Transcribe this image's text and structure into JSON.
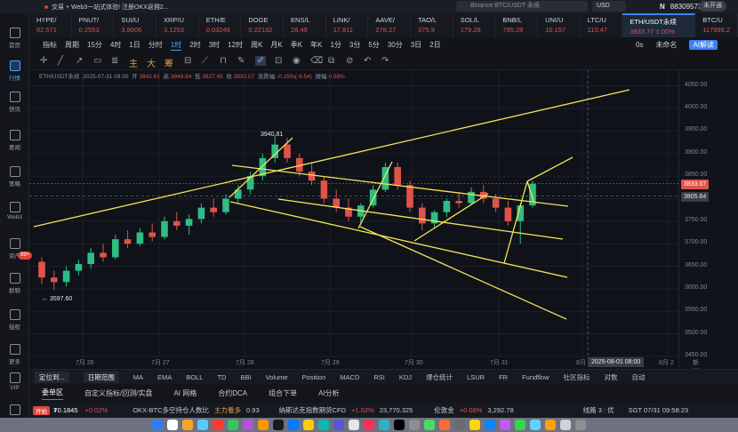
{
  "top_bar": {
    "title": "交易 + Web3一站式体验! 注册OKX返佣2...",
    "search_placeholder": "Binance BTC/USDT 永续",
    "currency": "USD",
    "account_id": "88309573",
    "account_badge": "未开通",
    "n_icon": "N"
  },
  "sidebar": {
    "items": [
      {
        "label": "首页",
        "icon": "home-icon"
      },
      {
        "label": "行情",
        "icon": "chart-icon"
      },
      {
        "label": "快讯",
        "icon": "news-icon"
      },
      {
        "label": "要闻",
        "icon": "article-icon"
      },
      {
        "label": "策略",
        "icon": "strategy-icon"
      },
      {
        "label": "Web3",
        "icon": "web3-icon"
      },
      {
        "label": "资产",
        "icon": "wallet-icon"
      },
      {
        "label": "群聊",
        "icon": "chat-icon"
      },
      {
        "label": "授权",
        "icon": "key-icon"
      },
      {
        "label": "更多",
        "icon": "more-icon"
      },
      {
        "label": "VIP",
        "icon": "vip-icon"
      },
      {
        "label": "",
        "icon": "settings-icon"
      }
    ],
    "badge": "99+"
  },
  "tickers": [
    {
      "name": "HYPE/",
      "price": "62.571",
      "color": "#e0534a"
    },
    {
      "name": "PNUT/",
      "price": "0.2553",
      "color": "#e0534a"
    },
    {
      "name": "SUI/U",
      "price": "3.8006",
      "color": "#e0534a"
    },
    {
      "name": "XRP/U",
      "price": "3.1253",
      "color": "#e0534a"
    },
    {
      "name": "ETH/E",
      "price": "0.03249",
      "color": "#e0534a"
    },
    {
      "name": "DOGE",
      "price": "0.22132",
      "color": "#e0534a"
    },
    {
      "name": "ENS/L",
      "price": "28.49",
      "color": "#e0534a"
    },
    {
      "name": "LINK/",
      "price": "17.811",
      "color": "#e0534a"
    },
    {
      "name": "AAVE/",
      "price": "278.27",
      "color": "#e0534a"
    },
    {
      "name": "TAO/L",
      "price": "375.9",
      "color": "#e0534a"
    },
    {
      "name": "SOL/L",
      "price": "179.29",
      "color": "#e0534a"
    },
    {
      "name": "BNB/L",
      "price": "795.28",
      "color": "#e0534a"
    },
    {
      "name": "UNI/U",
      "price": "10.157",
      "color": "#e0534a"
    },
    {
      "name": "LTC/U",
      "price": "110.47",
      "color": "#e0534a"
    },
    {
      "name": "ETH/USDT永续",
      "price": "3833.77  1.00%",
      "color": "#e0534a",
      "active": true
    },
    {
      "name": "BTC/U",
      "price": "117999.2",
      "color": "#e0534a"
    }
  ],
  "toolbar": {
    "items": [
      "指标",
      "周期",
      "15分",
      "4时",
      "1日",
      "分时",
      "1时",
      "2时",
      "3时",
      "12时",
      "周K",
      "月K",
      "季K",
      "年K",
      "1分",
      "3分",
      "5分",
      "30分",
      "3日",
      "2日"
    ],
    "selected": "1时",
    "right_items": [
      "0s",
      "未命名",
      "AI解读"
    ]
  },
  "legend": {
    "symbol": "ETH/USDT永续",
    "datetime": "2025-07-31 09:00",
    "open_label": "开",
    "open": "3842.61",
    "high_label": "高",
    "high": "3849.84",
    "low_label": "低",
    "low": "3827.45",
    "close_label": "收",
    "close": "3833.07",
    "change_label": "涨跌幅",
    "change": "-0.25%(-9.54)",
    "amp_label": "振幅",
    "amp": "0.58%"
  },
  "price_axis": {
    "ticks": [
      "4050.00",
      "4000.00",
      "3950.00",
      "3900.00",
      "3850.00",
      "3750.00",
      "3700.00",
      "3650.00",
      "3600.00",
      "3550.00",
      "3500.00",
      "3450.00"
    ],
    "current_price": "3833.07",
    "crosshair_price": "3805.64"
  },
  "chart_annotations": {
    "high_label": "3940.81",
    "low_label": "3597.60"
  },
  "time_axis": {
    "ticks": [
      "7月 26",
      "7月 27",
      "7月 28",
      "7月 29",
      "7月 30",
      "7月 31",
      "8月",
      "8月 2"
    ],
    "crosshair_time": "2025-08-01 08:00",
    "right_label": "新增"
  },
  "indicator_bar": {
    "left": [
      "定位到...",
      "日期范围"
    ],
    "items": [
      "MA",
      "EMA",
      "BOLL",
      "TD",
      "BBI",
      "Volume",
      "Position",
      "MACD",
      "RSI",
      "KDJ",
      "爆仓统计",
      "LSUR",
      "FR",
      "Fundflow"
    ],
    "right": [
      "社区指标",
      "对数",
      "自动"
    ]
  },
  "bottom_tabs": {
    "items": [
      "委单区",
      "自定义指标/回测/实盘",
      "AI 网格",
      "合约DCA",
      "组合下单",
      "AI分析"
    ],
    "active": "委单区"
  },
  "status_bar": {
    "live": "开始",
    "price1": "₮0.1845",
    "chg1": "+0.02%",
    "item2": "OKX-BTC多空持仓人数比",
    "item2_sub": "主力看多",
    "val2": "0.93",
    "item3": "纳斯达克指数期货CFD",
    "chg3": "+1.02%",
    "val3": "23,770.325",
    "item4": "伦敦金",
    "chg4": "+0.08%",
    "val4": "3,292.78",
    "lines": "线路 3 : 优",
    "time": "SGT 07/31 09:58:23"
  },
  "chart_data": {
    "type": "candlestick",
    "symbol": "ETH/USDT永续",
    "interval": "1时",
    "ylim": [
      3450,
      4075
    ],
    "candles": [
      {
        "o": 3660,
        "h": 3670,
        "l": 3610,
        "c": 3625
      },
      {
        "o": 3625,
        "h": 3640,
        "l": 3597.6,
        "c": 3615
      },
      {
        "o": 3615,
        "h": 3650,
        "l": 3605,
        "c": 3640
      },
      {
        "o": 3640,
        "h": 3665,
        "l": 3630,
        "c": 3655
      },
      {
        "o": 3655,
        "h": 3690,
        "l": 3645,
        "c": 3680
      },
      {
        "o": 3680,
        "h": 3700,
        "l": 3660,
        "c": 3670
      },
      {
        "o": 3670,
        "h": 3720,
        "l": 3665,
        "c": 3710
      },
      {
        "o": 3710,
        "h": 3730,
        "l": 3690,
        "c": 3700
      },
      {
        "o": 3700,
        "h": 3735,
        "l": 3695,
        "c": 3725
      },
      {
        "o": 3725,
        "h": 3745,
        "l": 3705,
        "c": 3715
      },
      {
        "o": 3715,
        "h": 3760,
        "l": 3710,
        "c": 3750
      },
      {
        "o": 3750,
        "h": 3770,
        "l": 3730,
        "c": 3740
      },
      {
        "o": 3740,
        "h": 3765,
        "l": 3720,
        "c": 3755
      },
      {
        "o": 3755,
        "h": 3790,
        "l": 3745,
        "c": 3780
      },
      {
        "o": 3780,
        "h": 3800,
        "l": 3760,
        "c": 3770
      },
      {
        "o": 3770,
        "h": 3810,
        "l": 3765,
        "c": 3800
      },
      {
        "o": 3800,
        "h": 3830,
        "l": 3790,
        "c": 3820
      },
      {
        "o": 3820,
        "h": 3860,
        "l": 3810,
        "c": 3850
      },
      {
        "o": 3850,
        "h": 3900,
        "l": 3840,
        "c": 3890
      },
      {
        "o": 3890,
        "h": 3940.81,
        "l": 3880,
        "c": 3920
      },
      {
        "o": 3920,
        "h": 3935,
        "l": 3880,
        "c": 3890
      },
      {
        "o": 3890,
        "h": 3900,
        "l": 3850,
        "c": 3860
      },
      {
        "o": 3860,
        "h": 3880,
        "l": 3830,
        "c": 3840
      },
      {
        "o": 3840,
        "h": 3850,
        "l": 3790,
        "c": 3800
      },
      {
        "o": 3800,
        "h": 3820,
        "l": 3770,
        "c": 3780
      },
      {
        "o": 3780,
        "h": 3800,
        "l": 3750,
        "c": 3760
      },
      {
        "o": 3760,
        "h": 3790,
        "l": 3745,
        "c": 3785
      },
      {
        "o": 3785,
        "h": 3830,
        "l": 3780,
        "c": 3820
      },
      {
        "o": 3820,
        "h": 3880,
        "l": 3815,
        "c": 3870
      },
      {
        "o": 3870,
        "h": 3880,
        "l": 3820,
        "c": 3830
      },
      {
        "o": 3830,
        "h": 3840,
        "l": 3770,
        "c": 3780
      },
      {
        "o": 3780,
        "h": 3790,
        "l": 3730,
        "c": 3745
      },
      {
        "o": 3745,
        "h": 3775,
        "l": 3735,
        "c": 3770
      },
      {
        "o": 3770,
        "h": 3800,
        "l": 3760,
        "c": 3795
      },
      {
        "o": 3795,
        "h": 3815,
        "l": 3780,
        "c": 3790
      },
      {
        "o": 3790,
        "h": 3825,
        "l": 3785,
        "c": 3815
      },
      {
        "o": 3815,
        "h": 3830,
        "l": 3790,
        "c": 3800
      },
      {
        "o": 3800,
        "h": 3810,
        "l": 3770,
        "c": 3780
      },
      {
        "o": 3780,
        "h": 3795,
        "l": 3740,
        "c": 3750
      },
      {
        "o": 3750,
        "h": 3790,
        "l": 3700,
        "c": 3785
      },
      {
        "o": 3785,
        "h": 3840,
        "l": 3780,
        "c": 3833.07
      }
    ]
  }
}
